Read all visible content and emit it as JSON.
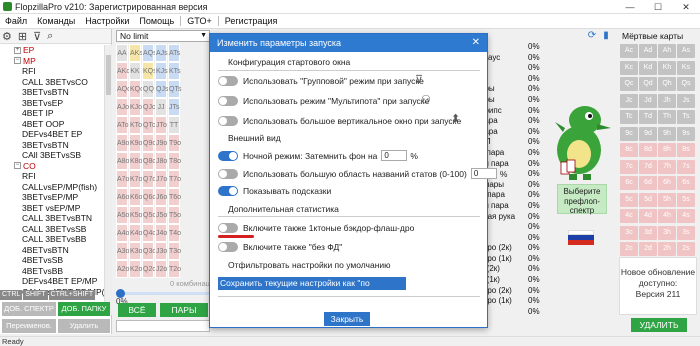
{
  "window": {
    "title": "FlopzillaPro v210: Зарегистрированная версия"
  },
  "menu": [
    "Файл",
    "Команды",
    "Настройки",
    "Помощь",
    "GTO+",
    "Регистрация"
  ],
  "tree": [
    {
      "text": "EP",
      "lvl": 0,
      "red": true,
      "box": "+"
    },
    {
      "text": "MP",
      "lvl": 0,
      "red": true,
      "box": "−"
    },
    {
      "text": "RFI",
      "lvl": 1
    },
    {
      "text": "CALL 3BETvsCO",
      "lvl": 1
    },
    {
      "text": "3BETvsBTN",
      "lvl": 1
    },
    {
      "text": "3BETvsEP",
      "lvl": 1
    },
    {
      "text": "4BET IP",
      "lvl": 1
    },
    {
      "text": "4BET OOP",
      "lvl": 1
    },
    {
      "text": "DEFvs4BET EP",
      "lvl": 1
    },
    {
      "text": "3BETvsBTN",
      "lvl": 1
    },
    {
      "text": "CAll 3BETvsSB",
      "lvl": 1
    },
    {
      "text": "CO",
      "lvl": 0,
      "red": true,
      "box": "−"
    },
    {
      "text": "RFI",
      "lvl": 1
    },
    {
      "text": "CALLvsEP/MP(fish)",
      "lvl": 1
    },
    {
      "text": "3BETvsEP/MP",
      "lvl": 1
    },
    {
      "text": "3BET vsEP/MP",
      "lvl": 1
    },
    {
      "text": "CALL 3BETvsBTN",
      "lvl": 1
    },
    {
      "text": "CALL 3BETvsSB",
      "lvl": 1
    },
    {
      "text": "CALL 3BETvsBB",
      "lvl": 1
    },
    {
      "text": "4BETvsBTN",
      "lvl": 1
    },
    {
      "text": "4BETvsSB",
      "lvl": 1
    },
    {
      "text": "4BETvsBB",
      "lvl": 1
    },
    {
      "text": "DEFvs4BET EP/MP",
      "lvl": 1
    },
    {
      "text": "CALLvs4BET EP/MP(fish)",
      "lvl": 1
    }
  ],
  "left_shortcuts": [
    "CTRL",
    "SHIFT",
    "CTRL+SHIFT"
  ],
  "left_buttons": {
    "add_spectrum": "ДОБ. СПЕКТР",
    "add_folder": "ДОБ. ПАПКУ",
    "rename": "Переименов.",
    "delete": "Удалить"
  },
  "matrix": {
    "range_select": "No limit",
    "combos_label": "0 комбинаций",
    "slider_value": "0%",
    "btn_all": "ВСЁ",
    "btn_pairs": "ПАРЫ",
    "rows": [
      [
        "AA",
        "AKs",
        "AQs",
        "AJs",
        "ATs"
      ],
      [
        "AKo",
        "KK",
        "KQs",
        "KJs",
        "KTs"
      ],
      [
        "AQo",
        "KQo",
        "QQ",
        "QJs",
        "QTs"
      ],
      [
        "AJo",
        "KJo",
        "QJo",
        "JJ",
        "JTs"
      ],
      [
        "ATo",
        "KTo",
        "QTo",
        "JTo",
        "TT"
      ],
      [
        "A9o",
        "K9o",
        "Q9o",
        "J9o",
        "T9o"
      ],
      [
        "A8o",
        "K8o",
        "Q8o",
        "J8o",
        "T8o"
      ],
      [
        "A7o",
        "K7o",
        "Q7o",
        "J7o",
        "T7o"
      ],
      [
        "A6o",
        "K6o",
        "Q6o",
        "J6o",
        "T6o"
      ],
      [
        "A5o",
        "K5o",
        "Q5o",
        "J5o",
        "T5o"
      ],
      [
        "A4o",
        "K4o",
        "Q4o",
        "J4o",
        "T4o"
      ],
      [
        "A3o",
        "K3o",
        "Q3o",
        "J3o",
        "T3o"
      ],
      [
        "A2o",
        "K2o",
        "Q2o",
        "J2o",
        "T2o"
      ]
    ]
  },
  "stats": [
    {
      "label": "",
      "pct": "0%"
    },
    {
      "label": "-Хаус",
      "pct": "0%"
    },
    {
      "label": "",
      "pct": "0%"
    },
    {
      "label": "",
      "pct": "0%"
    },
    {
      "label": "ары",
      "pct": "0%"
    },
    {
      "label": "ары",
      "pct": "0%"
    },
    {
      "label": "Трипс",
      "pct": "0%"
    },
    {
      "label": "пара",
      "pct": "0%"
    },
    {
      "label": "пара",
      "pct": "0%"
    },
    {
      "label": "ТП",
      "pct": "0%"
    },
    {
      "label": "я пара",
      "pct": "0%"
    },
    {
      "label": "ая пара",
      "pct": "0%"
    },
    {
      "label": "ТП",
      "pct": "0%"
    },
    {
      "label": "т.пары",
      "pct": "0%"
    },
    {
      "label": "т. пара",
      "pct": "0%"
    },
    {
      "label": "ая пара",
      "pct": "0%"
    },
    {
      "label": "стая рука",
      "pct": "0%"
    },
    {
      "label": "",
      "pct": "0%"
    },
    {
      "label": "",
      "pct": "0%"
    },
    {
      "label": "-дро (2к)",
      "pct": "0%"
    },
    {
      "label": "-дро (1к)",
      "pct": "0%"
    },
    {
      "label": "е (2к)",
      "pct": "0%"
    },
    {
      "label": "е (1к)",
      "pct": "0%"
    },
    {
      "label": "-дро (2к)",
      "pct": "0%"
    },
    {
      "label": "-дро (1к)",
      "pct": "0%"
    },
    {
      "label": "ы",
      "pct": "0%"
    }
  ],
  "right_panel": {
    "dead_cards_label": "Мёртвые карты",
    "cards": [
      [
        "Ac",
        "Ad",
        "Ah",
        "As"
      ],
      [
        "Kc",
        "Kd",
        "Kh",
        "Ks"
      ],
      [
        "Qc",
        "Qd",
        "Qh",
        "Qs"
      ],
      [
        "Jc",
        "Jd",
        "Jh",
        "Js"
      ],
      [
        "Tc",
        "Td",
        "Th",
        "Ts"
      ],
      [
        "9c",
        "9d",
        "9h",
        "9s"
      ],
      [
        "8c",
        "8d",
        "8h",
        "8s"
      ],
      [
        "7c",
        "7d",
        "7h",
        "7s"
      ],
      [
        "6c",
        "6d",
        "6h",
        "6s"
      ],
      [
        "5c",
        "5d",
        "5h",
        "5s"
      ],
      [
        "4c",
        "4d",
        "4h",
        "4s"
      ],
      [
        "3c",
        "3d",
        "3h",
        "3s"
      ],
      [
        "2c",
        "2d",
        "2h",
        "2s"
      ]
    ],
    "preflop_btn": "Выберите префлоп-спектр",
    "update_text_1": "Новое обновление",
    "update_text_2": "доступно:",
    "update_text_3": "Версия 211",
    "delete_btn": "УДАЛИТЬ"
  },
  "status": "Ready",
  "modal": {
    "title": "Изменить параметры запуска",
    "close": "✕",
    "sec_start": "Конфигурация стартового окна",
    "opt_group": "Использовать \"Групповой\" режим при запуске",
    "opt_multitool": "Использовать режим \"Мультипота\" при запуске",
    "opt_tall": "Использовать большое вертикальное окно при запуске",
    "sec_look": "Внешний вид",
    "opt_night": "Ночной режим: Затемнить фон на",
    "night_value": "0",
    "night_unit": "%",
    "opt_bigstats": "Использовать большую область названий статов (0-100)",
    "bigstats_value": "0",
    "bigstats_unit": "%",
    "opt_hints": "Показывать подсказки",
    "sec_extra": "Дополнительная статистика",
    "opt_backdoor": "Включите также 1ктоные бэкдор-флаш-дро",
    "opt_nofd": "Включите также \"без ФД\"",
    "sec_filter": "Отфильтровать настройки по умолчанию",
    "save_default": "Сохранить текущие настройки как \"по умолчанию\"",
    "close_btn": "Закрыть"
  },
  "colors": {
    "accent": "#2e74c9",
    "green": "#2ea444",
    "danger": "#d42020"
  }
}
